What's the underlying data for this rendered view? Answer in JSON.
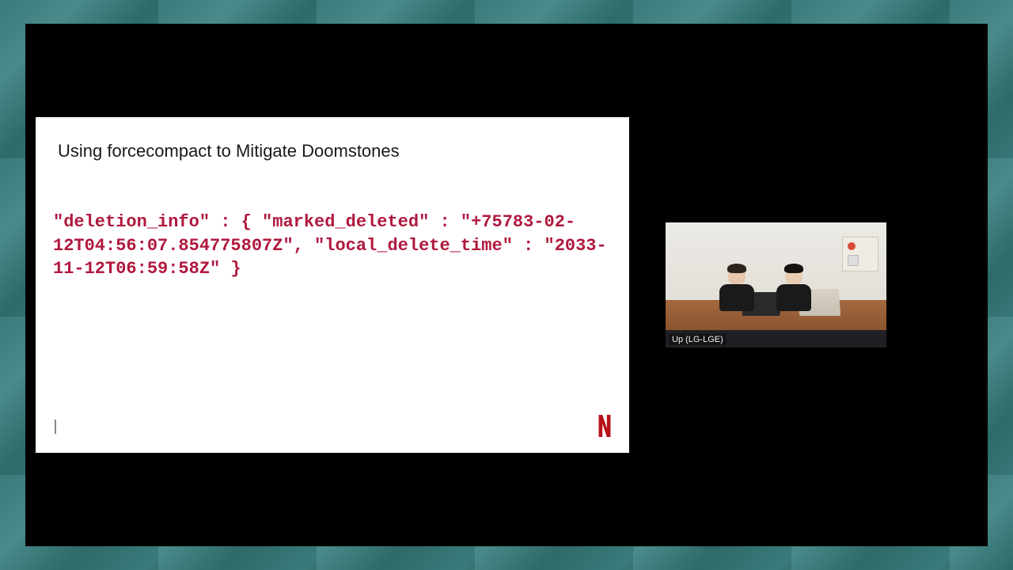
{
  "slide": {
    "title": "Using forcecompact to Mitigate Doomstones",
    "code": "\"deletion_info\" : { \"marked_deleted\" : \"+75783-02-12T04:56:07.854775807Z\", \"local_delete_time\" : \"2033-11-12T06:59:58Z\" }",
    "brand": "N",
    "brand_color": "#b8121b"
  },
  "webcam": {
    "label": "Up (LG-LGE)"
  }
}
